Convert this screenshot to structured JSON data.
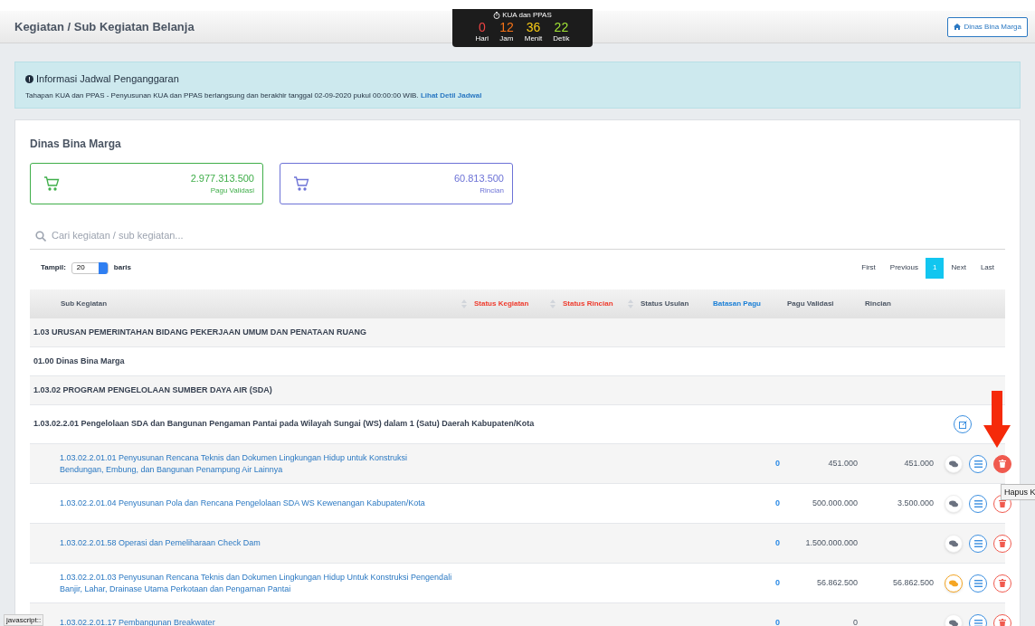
{
  "header": {
    "title": "Kegiatan / Sub Kegiatan Belanja",
    "button": "Dinas Bina Marga"
  },
  "countdown": {
    "title": "KUA dan PPAS",
    "units": [
      {
        "value": "0",
        "label": "Hari",
        "color": "#ef4444"
      },
      {
        "value": "12",
        "label": "Jam",
        "color": "#f97316"
      },
      {
        "value": "36",
        "label": "Menit",
        "color": "#facc15"
      },
      {
        "value": "22",
        "label": "Detik",
        "color": "#a3e635"
      }
    ]
  },
  "info": {
    "title": "Informasi Jadwal Penganggaran",
    "text": "Tahapan KUA dan PPAS - Penyusunan KUA dan PPAS berlangsung dan berakhir tanggal 02-09-2020 pukul 00:00:00 WIB.",
    "link": "Lihat Detil Jadwal"
  },
  "card": {
    "title": "Dinas Bina Marga",
    "stats": [
      {
        "value": "2.977.313.500",
        "label": "Pagu Validasi",
        "color": "#3fae49"
      },
      {
        "value": "60.813.500",
        "label": "Rincian",
        "color": "#6c72d6"
      }
    ],
    "search": {
      "placeholder": "Cari kegiatan / sub kegiatan..."
    },
    "page_size": {
      "label": "Tampil:",
      "value": "20",
      "suffix": "baris"
    },
    "pagination": [
      {
        "label": "First",
        "selected": false
      },
      {
        "label": "Previous",
        "selected": false
      },
      {
        "label": "1",
        "selected": true
      },
      {
        "label": "Next",
        "selected": false
      },
      {
        "label": "Last",
        "selected": false
      }
    ],
    "table": {
      "columns": [
        {
          "label": "Sub Kegiatan",
          "sortable": true,
          "color": "#4b5563"
        },
        {
          "label": "Status Kegiatan",
          "sortable": true,
          "color": "#ef3b2d"
        },
        {
          "label": "Status Rincian",
          "sortable": true,
          "color": "#ef3b2d"
        },
        {
          "label": "Status Usulan",
          "sortable": false,
          "color": "#4b5563"
        },
        {
          "label": "Batasan Pagu",
          "sortable": false,
          "color": "#1a7fd6"
        },
        {
          "label": "Pagu Validasi",
          "sortable": false,
          "color": "#4b5563"
        },
        {
          "label": "Rincian",
          "sortable": false,
          "color": "#4b5563"
        }
      ],
      "rows": [
        {
          "kind": "group",
          "label": "1.03 URUSAN PEMERINTAHAN BIDANG PEKERJAAN UMUM DAN PENATAAN RUANG"
        },
        {
          "kind": "unit",
          "label": "01.00 Dinas Bina Marga"
        },
        {
          "kind": "group",
          "label": "1.03.02 PROGRAM PENGELOLAAN SUMBER DAYA AIR (SDA)"
        },
        {
          "kind": "kegiatan",
          "label": "1.03.02.2.01 Pengelolaan SDA dan Bangunan Pengaman Pantai pada Wilayah Sungai (WS) dalam 1 (Satu) Daerah Kabupaten/Kota"
        },
        {
          "kind": "sub",
          "label": "1.03.02.2.01.01 Penyusunan Rencana Teknis dan Dokumen Lingkungan Hidup untuk Konstruksi Bendungan, Embung, dan Bangunan Penampung Air Lainnya",
          "batasan": "0",
          "pagu": "451.000",
          "rincian": "451.000",
          "chat_alert": false,
          "delete_active": true
        },
        {
          "kind": "sub",
          "label": "1.03.02.2.01.04 Penyusunan Pola dan Rencana Pengelolaan SDA WS Kewenangan Kabupaten/Kota",
          "batasan": "0",
          "pagu": "500.000.000",
          "rincian": "3.500.000",
          "chat_alert": false,
          "delete_active": false
        },
        {
          "kind": "sub",
          "label": "1.03.02.2.01.58 Operasi dan Pemeliharaan Check Dam",
          "batasan": "0",
          "pagu": "1.500.000.000",
          "chat_alert": false,
          "delete_active": false
        },
        {
          "kind": "sub",
          "label": "1.03.02.2.01.03 Penyusunan Rencana Teknis dan Dokumen Lingkungan Hidup Untuk Konstruksi Pengendali Banjir, Lahar, Drainase Utama Perkotaan dan Pengaman Pantai",
          "batasan": "0",
          "pagu": "56.862.500",
          "rincian": "56.862.500",
          "chat_alert": true,
          "delete_active": false
        },
        {
          "kind": "sub",
          "label": "1.03.02.2.01.17 Pembangunan Breakwater",
          "batasan": "0",
          "pagu": "0",
          "chat_alert": false,
          "delete_active": false
        }
      ]
    }
  },
  "tooltip": "Hapus K",
  "status_bar": "javascript::"
}
